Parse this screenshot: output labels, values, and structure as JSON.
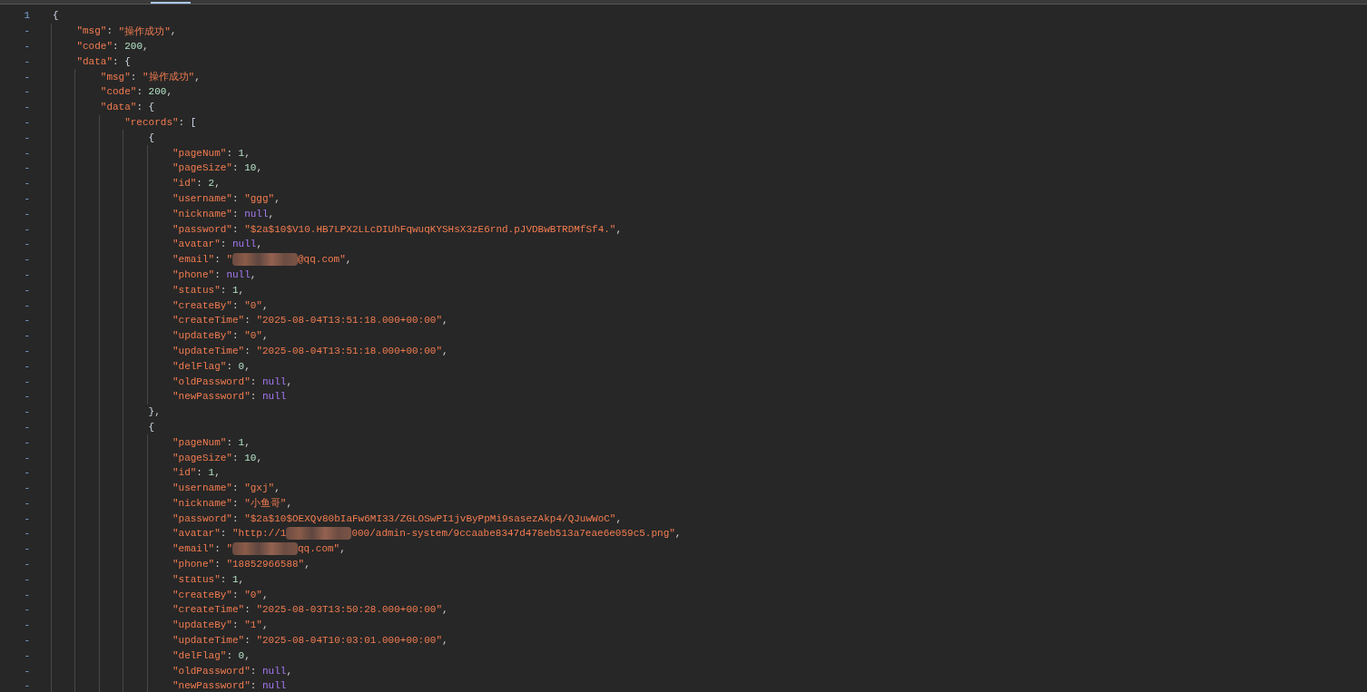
{
  "tabs": [
    {
      "selected": true
    }
  ],
  "lines": [
    {
      "gutter": "1",
      "value": "{",
      "kind": "punct",
      "children": [
        {
          "gutter": "-",
          "key": "\"msg\"",
          "sep": ": ",
          "value": "\"操作成功\"",
          "kind": "string",
          "end": ","
        },
        {
          "gutter": "-",
          "key": "\"code\"",
          "sep": ": ",
          "value": "200",
          "kind": "number",
          "end": ","
        },
        {
          "gutter": "-",
          "key": "\"data\"",
          "sep": ": ",
          "value": "{",
          "kind": "punct",
          "children": [
            {
              "gutter": "-",
              "key": "\"msg\"",
              "sep": ": ",
              "value": "\"操作成功\"",
              "kind": "string",
              "end": ","
            },
            {
              "gutter": "-",
              "key": "\"code\"",
              "sep": ": ",
              "value": "200",
              "kind": "number",
              "end": ","
            },
            {
              "gutter": "-",
              "key": "\"data\"",
              "sep": ": ",
              "value": "{",
              "kind": "punct",
              "children": [
                {
                  "gutter": "-",
                  "key": "\"records\"",
                  "sep": ": ",
                  "value": "[",
                  "kind": "punct",
                  "children": [
                    {
                      "gutter": "-",
                      "value": "{",
                      "kind": "punct",
                      "children": [
                        {
                          "gutter": "-",
                          "key": "\"pageNum\"",
                          "sep": ": ",
                          "value": "1",
                          "kind": "number",
                          "end": ","
                        },
                        {
                          "gutter": "-",
                          "key": "\"pageSize\"",
                          "sep": ": ",
                          "value": "10",
                          "kind": "number",
                          "end": ","
                        },
                        {
                          "gutter": "-",
                          "key": "\"id\"",
                          "sep": ": ",
                          "value": "2",
                          "kind": "number",
                          "end": ","
                        },
                        {
                          "gutter": "-",
                          "key": "\"username\"",
                          "sep": ": ",
                          "value": "\"ggg\"",
                          "kind": "string",
                          "end": ","
                        },
                        {
                          "gutter": "-",
                          "key": "\"nickname\"",
                          "sep": ": ",
                          "value": "null",
                          "kind": "null",
                          "end": ","
                        },
                        {
                          "gutter": "-",
                          "key": "\"password\"",
                          "sep": ": ",
                          "value": "\"$2a$10$V10.HB7LPX2LLcDIUhFqwuqKYSHsX3zE6rnd.pJVDBwBTRDMfSf4.\"",
                          "kind": "string",
                          "end": ","
                        },
                        {
                          "gutter": "-",
                          "key": "\"avatar\"",
                          "sep": ": ",
                          "value": "null",
                          "kind": "null",
                          "end": ","
                        },
                        {
                          "gutter": "-",
                          "key": "\"email\"",
                          "sep": ": ",
                          "value": "\"",
                          "redacted": true,
                          "value_after": "@qq.com\"",
                          "kind": "string",
                          "end": ","
                        },
                        {
                          "gutter": "-",
                          "key": "\"phone\"",
                          "sep": ": ",
                          "value": "null",
                          "kind": "null",
                          "end": ","
                        },
                        {
                          "gutter": "-",
                          "key": "\"status\"",
                          "sep": ": ",
                          "value": "1",
                          "kind": "number",
                          "end": ","
                        },
                        {
                          "gutter": "-",
                          "key": "\"createBy\"",
                          "sep": ": ",
                          "value": "\"0\"",
                          "kind": "string",
                          "end": ","
                        },
                        {
                          "gutter": "-",
                          "key": "\"createTime\"",
                          "sep": ": ",
                          "value": "\"2025-08-04T13:51:18.000+00:00\"",
                          "kind": "string",
                          "end": ","
                        },
                        {
                          "gutter": "-",
                          "key": "\"updateBy\"",
                          "sep": ": ",
                          "value": "\"0\"",
                          "kind": "string",
                          "end": ","
                        },
                        {
                          "gutter": "-",
                          "key": "\"updateTime\"",
                          "sep": ": ",
                          "value": "\"2025-08-04T13:51:18.000+00:00\"",
                          "kind": "string",
                          "end": ","
                        },
                        {
                          "gutter": "-",
                          "key": "\"delFlag\"",
                          "sep": ": ",
                          "value": "0",
                          "kind": "number",
                          "end": ","
                        },
                        {
                          "gutter": "-",
                          "key": "\"oldPassword\"",
                          "sep": ": ",
                          "value": "null",
                          "kind": "null",
                          "end": ","
                        },
                        {
                          "gutter": "-",
                          "key": "\"newPassword\"",
                          "sep": ": ",
                          "value": "null",
                          "kind": "null"
                        }
                      ]
                    },
                    {
                      "gutter": "-",
                      "value": "}",
                      "kind": "punct",
                      "end": ","
                    },
                    {
                      "gutter": "-",
                      "value": "{",
                      "kind": "punct",
                      "children": [
                        {
                          "gutter": "-",
                          "key": "\"pageNum\"",
                          "sep": ": ",
                          "value": "1",
                          "kind": "number",
                          "end": ","
                        },
                        {
                          "gutter": "-",
                          "key": "\"pageSize\"",
                          "sep": ": ",
                          "value": "10",
                          "kind": "number",
                          "end": ","
                        },
                        {
                          "gutter": "-",
                          "key": "\"id\"",
                          "sep": ": ",
                          "value": "1",
                          "kind": "number",
                          "end": ","
                        },
                        {
                          "gutter": "-",
                          "key": "\"username\"",
                          "sep": ": ",
                          "value": "\"gxj\"",
                          "kind": "string",
                          "end": ","
                        },
                        {
                          "gutter": "-",
                          "key": "\"nickname\"",
                          "sep": ": ",
                          "value": "\"小鱼哥\"",
                          "kind": "string",
                          "end": ","
                        },
                        {
                          "gutter": "-",
                          "key": "\"password\"",
                          "sep": ": ",
                          "value": "\"$2a$10$OEXQv80bIaFw6MI33/ZGLOSwPI1jvByPpMi9sasezAkp4/QJuwWoC\"",
                          "kind": "string",
                          "end": ","
                        },
                        {
                          "gutter": "-",
                          "key": "\"avatar\"",
                          "sep": ": ",
                          "value": "\"http://1",
                          "redacted": true,
                          "value_after": "000/admin-system/9ccaabe8347d478eb513a7eae6e059c5.png\"",
                          "kind": "string",
                          "end": ","
                        },
                        {
                          "gutter": "-",
                          "key": "\"email\"",
                          "sep": ": ",
                          "value": "\"",
                          "redacted": true,
                          "value_after": "qq.com\"",
                          "kind": "string",
                          "end": ","
                        },
                        {
                          "gutter": "-",
                          "key": "\"phone\"",
                          "sep": ": ",
                          "value": "\"18852966588\"",
                          "kind": "string",
                          "end": ","
                        },
                        {
                          "gutter": "-",
                          "key": "\"status\"",
                          "sep": ": ",
                          "value": "1",
                          "kind": "number",
                          "end": ","
                        },
                        {
                          "gutter": "-",
                          "key": "\"createBy\"",
                          "sep": ": ",
                          "value": "\"0\"",
                          "kind": "string",
                          "end": ","
                        },
                        {
                          "gutter": "-",
                          "key": "\"createTime\"",
                          "sep": ": ",
                          "value": "\"2025-08-03T13:50:28.000+00:00\"",
                          "kind": "string",
                          "end": ","
                        },
                        {
                          "gutter": "-",
                          "key": "\"updateBy\"",
                          "sep": ": ",
                          "value": "\"1\"",
                          "kind": "string",
                          "end": ","
                        },
                        {
                          "gutter": "-",
                          "key": "\"updateTime\"",
                          "sep": ": ",
                          "value": "\"2025-08-04T10:03:01.000+00:00\"",
                          "kind": "string",
                          "end": ","
                        },
                        {
                          "gutter": "-",
                          "key": "\"delFlag\"",
                          "sep": ": ",
                          "value": "0",
                          "kind": "number",
                          "end": ","
                        },
                        {
                          "gutter": "-",
                          "key": "\"oldPassword\"",
                          "sep": ": ",
                          "value": "null",
                          "kind": "null",
                          "end": ","
                        },
                        {
                          "gutter": "-",
                          "key": "\"newPassword\"",
                          "sep": ": ",
                          "value": "null",
                          "kind": "null"
                        }
                      ]
                    }
                  ]
                }
              ]
            }
          ]
        }
      ]
    }
  ]
}
